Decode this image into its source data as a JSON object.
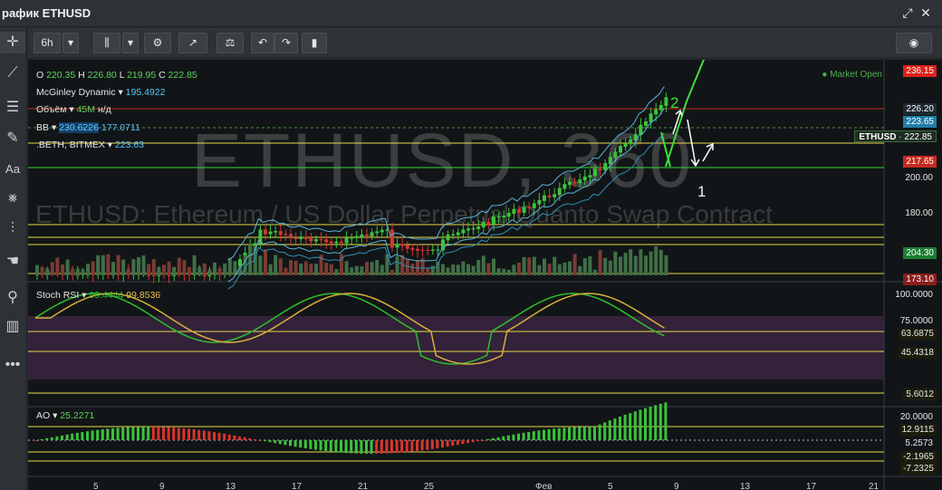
{
  "window": {
    "title": "рафик ETHUSD"
  },
  "toolbar": {
    "interval": "6h",
    "items": [
      "chart-type",
      "settings",
      "indicators",
      "compare",
      "undo",
      "redo",
      "data-window",
      "snapshot"
    ]
  },
  "left_tools": [
    "crosshair",
    "trendline",
    "horizontal-lines",
    "brush",
    "text",
    "pattern",
    "fib",
    "hand",
    "zoom",
    "ruler",
    "more"
  ],
  "legend": {
    "ohlc": {
      "o_label": "O",
      "o": "220.35",
      "h_label": "H",
      "h": "226.80",
      "l_label": "L",
      "l": "219.95",
      "c_label": "C",
      "c": "222.85"
    },
    "mcginley": {
      "label": "McGinley Dynamic",
      "value": "195.4922"
    },
    "volume": {
      "label": "Объём",
      "value": "45M",
      "unit": "н/д"
    },
    "bb": {
      "label": "BB",
      "value_upper": "230.6226",
      "value_lower": "177.0711"
    },
    "beth": {
      "label": ".BETH, BITMEX",
      "value": "223.63"
    }
  },
  "market_status": "Market Open",
  "watermark": {
    "symbol": "ETHUSD, 360",
    "description": "ETHUSD: Ethereum / US Dollar Perpetual Quanto Swap Contract"
  },
  "price_axis": {
    "tags": [
      {
        "text": "236.15",
        "color": "#e0201a"
      },
      {
        "text": "226.20",
        "color": "#1f2a33"
      },
      {
        "text": "223.65",
        "color": "#1f7ea8"
      },
      {
        "text": "217.65",
        "color": "#c62b1f"
      },
      {
        "text": "204.30",
        "color": "#1e7e34"
      },
      {
        "text": "173.10",
        "color": "#8a1c1c"
      }
    ],
    "ticks": [
      "200.00",
      "180.00"
    ],
    "symbol_tag": {
      "label": "ETHUSD",
      "value": "222.85"
    }
  },
  "stoch_rsi": {
    "label": "Stoch RSI",
    "k": "99.4444",
    "d": "99.8536",
    "axis": [
      "100.0000",
      "75.0000",
      "63.6875",
      "45.4318",
      "5.6012"
    ]
  },
  "ao": {
    "label": "AO",
    "value": "25.2271",
    "axis": [
      "20.0000",
      "12.9115",
      "5.2573",
      "-2.1965",
      "-7.2325"
    ]
  },
  "annotations": {
    "wave_2": "2",
    "wave_1": "1"
  },
  "x_axis": [
    "5",
    "9",
    "13",
    "17",
    "21",
    "25",
    "Фев",
    "5",
    "9",
    "13",
    "17",
    "21"
  ],
  "colors": {
    "up": "#3cc23c",
    "down": "#d8342e",
    "bg": "#121517",
    "stoch_k": "#2fbf2f",
    "stoch_d": "#d7b13a"
  }
}
